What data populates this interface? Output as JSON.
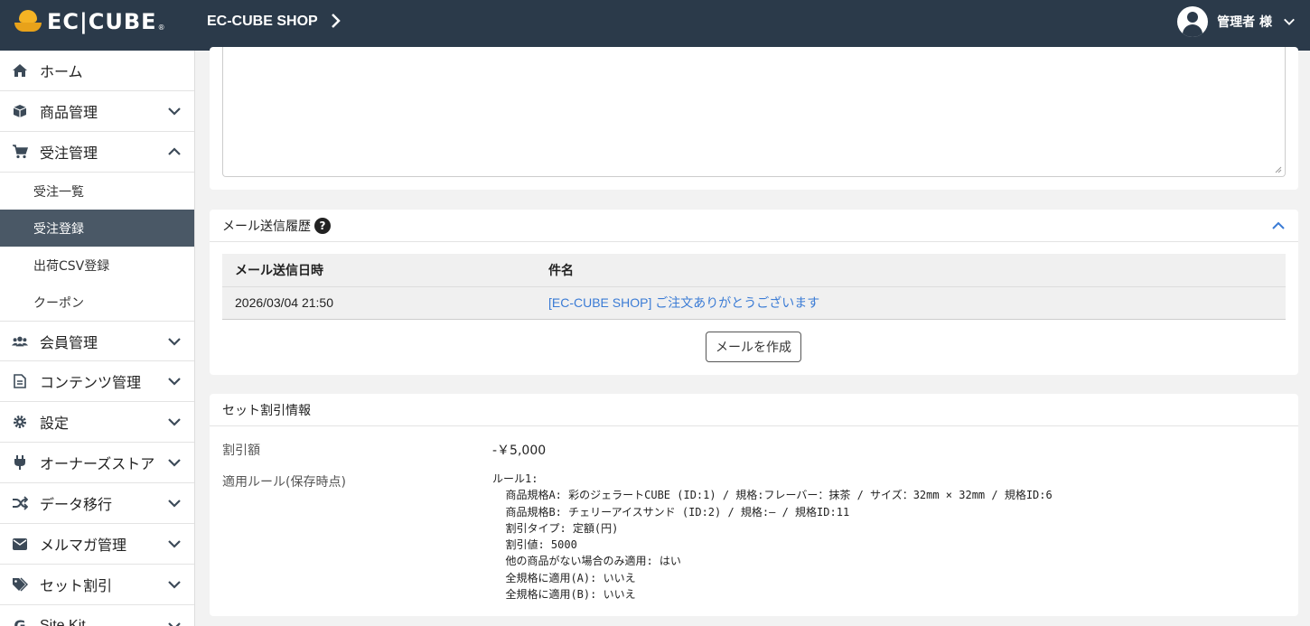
{
  "header": {
    "logo_text": "EC|CUBE",
    "shop_name": "EC-CUBE SHOP",
    "user_name": "管理者 様"
  },
  "sidebar": {
    "items": [
      {
        "label": "ホーム",
        "icon": "home-icon"
      },
      {
        "label": "商品管理",
        "icon": "box-icon"
      },
      {
        "label": "受注管理",
        "icon": "cart-icon"
      },
      {
        "label": "会員管理",
        "icon": "users-icon"
      },
      {
        "label": "コンテンツ管理",
        "icon": "file-icon"
      },
      {
        "label": "設定",
        "icon": "gear-icon"
      },
      {
        "label": "オーナーズストア",
        "icon": "plug-icon"
      },
      {
        "label": "データ移行",
        "icon": "shuffle-icon"
      },
      {
        "label": "メルマガ管理",
        "icon": "envelope-icon"
      },
      {
        "label": "セット割引",
        "icon": "tags-icon"
      },
      {
        "label": "Site Kit",
        "icon": "google-icon"
      }
    ],
    "order_sub": [
      "受注一覧",
      "受注登録",
      "出荷CSV登録",
      "クーポン"
    ]
  },
  "mail_history": {
    "title": "メール送信履歴",
    "col_date": "メール送信日時",
    "col_subject": "件名",
    "rows": [
      {
        "date": "2026/03/04 21:50",
        "subject": "[EC-CUBE SHOP] ご注文ありがとうございます"
      }
    ],
    "create_button": "メールを作成"
  },
  "set_discount": {
    "title": "セット割引情報",
    "discount_label": "割引額",
    "discount_value": "-￥5,000",
    "rule_label": "適用ルール(保存時点)",
    "rules_text": "ルール1:\n  商品規格A: 彩のジェラートCUBE (ID:1) / 規格:フレーバー：抹茶 / サイズ：32mm × 32mm / 規格ID:6\n  商品規格B: チェリーアイスサンド (ID:2) / 規格:– / 規格ID:11\n  割引タイプ: 定額(円)\n  割引値: 5000\n  他の商品がない場合のみ適用: はい\n  全規格に適用(A): いいえ\n  全規格に適用(B): いいえ"
  }
}
